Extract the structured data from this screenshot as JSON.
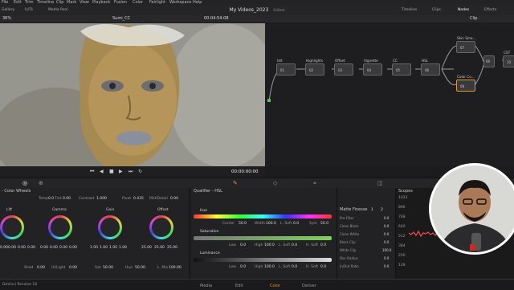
{
  "menubar": [
    "File",
    "Edit",
    "Trim",
    "Timeline",
    "Clip",
    "Mark",
    "View",
    "Playback",
    "Fusion",
    "Color",
    "Fairlight",
    "Workspace",
    "Help"
  ],
  "toolbar": {
    "left_items": [
      "Gallery",
      "LUTs",
      "Media Pool"
    ],
    "project_title": "My Videos_2023",
    "project_state": "Edited",
    "right_items": [
      "Timeline",
      "Clips",
      "Nodes",
      "Effects"
    ]
  },
  "viewer": {
    "clip_name": "Sumi_CC",
    "zoom": "36%",
    "timecode_top": "00:04:54:08",
    "timecode_bottom": "00:00:00:00"
  },
  "node_panel": {
    "mode": "Clip"
  },
  "nodes": [
    {
      "label": "Istt",
      "num": "01"
    },
    {
      "label": "Highlights",
      "num": "02"
    },
    {
      "label": "Offset",
      "num": "03"
    },
    {
      "label": "Vignette",
      "num": "04"
    },
    {
      "label": "CC",
      "num": "05"
    },
    {
      "label": "HSL",
      "num": "06"
    },
    {
      "label": "Skin Sma...",
      "num": "07"
    },
    {
      "label": "Color Co...",
      "num": "08"
    },
    {
      "label": "",
      "num": "09"
    },
    {
      "label": "CST",
      "num": "10"
    }
  ],
  "color_wheels": {
    "title": "- Color Wheels",
    "top_params": {
      "temp_label": "Temp",
      "temp": "0.0",
      "tint_label": "Tint",
      "tint": "0.00",
      "contrast_label": "Contrast",
      "contrast": "1.000",
      "pivot_label": "Pivot",
      "pivot": "0.435",
      "middetail_label": "Mid/Detail",
      "middetail": "0.00"
    },
    "wheels": [
      {
        "name": "Lift",
        "values": [
          "0.00",
          "0.00",
          "0.00",
          "0.00"
        ]
      },
      {
        "name": "Gamma",
        "values": [
          "0.00",
          "0.00",
          "0.00",
          "0.00"
        ]
      },
      {
        "name": "Gain",
        "values": [
          "1.00",
          "1.00",
          "1.00",
          "1.00"
        ]
      },
      {
        "name": "Offset",
        "values": [
          "25.00",
          "25.00",
          "25.00"
        ]
      }
    ],
    "bottom_params": {
      "shad_label": "Shad",
      "shad": "0.00",
      "hilight_label": "Hi/Light",
      "hilight": "0.00",
      "sat_label": "Sat",
      "sat": "50.00",
      "hue_label": "Hue",
      "hue": "50.00",
      "lmix_label": "L. Mix",
      "lmix": "100.00"
    }
  },
  "qualifier": {
    "title": "Qualifier - HSL",
    "hue": {
      "label": "Hue",
      "center_label": "Center",
      "center": "50.0",
      "width_label": "Width",
      "width": "100.0",
      "soft_label": "L. Soft",
      "soft": "0.0",
      "sym_label": "Sym",
      "sym": "50.0"
    },
    "saturation": {
      "label": "Saturation",
      "low_label": "Low",
      "low": "0.0",
      "high_label": "High",
      "high": "100.0",
      "lsoft_label": "L. Soft",
      "lsoft": "0.0",
      "hsoft_label": "H. Soft",
      "hsoft": "0.0"
    },
    "luminance": {
      "label": "Luminance",
      "low_label": "Low",
      "low": "0.0",
      "high_label": "High",
      "high": "100.0",
      "lsoft_label": "L. Soft",
      "lsoft": "0.0",
      "hsoft_label": "H. Soft",
      "hsoft": "0.0"
    }
  },
  "matte": {
    "title": "Matte Finesse",
    "tabs": [
      "1",
      "2"
    ],
    "rows": [
      {
        "label": "Pre-Filter",
        "value": "0.0"
      },
      {
        "label": "Clean Black",
        "value": "0.0"
      },
      {
        "label": "Clean White",
        "value": "0.0"
      },
      {
        "label": "Black Clip",
        "value": "0.0"
      },
      {
        "label": "White Clip",
        "value": "100.0"
      },
      {
        "label": "Blur Radius",
        "value": "0.0"
      },
      {
        "label": "In/Out Ratio",
        "value": "0.0"
      }
    ]
  },
  "scopes": {
    "title": "Scopes",
    "ticks": [
      "1023",
      "896",
      "768",
      "640",
      "512",
      "384",
      "256",
      "128"
    ]
  },
  "bottom_tabs": [
    "Media",
    "Edit",
    "Color",
    "Deliver"
  ],
  "active_tab": "Color",
  "app_name": "DaVinci Resolve 18",
  "colors": {
    "accent": "#e0952f",
    "node_line": "#3aa0ff",
    "good": "#7dd35b"
  }
}
